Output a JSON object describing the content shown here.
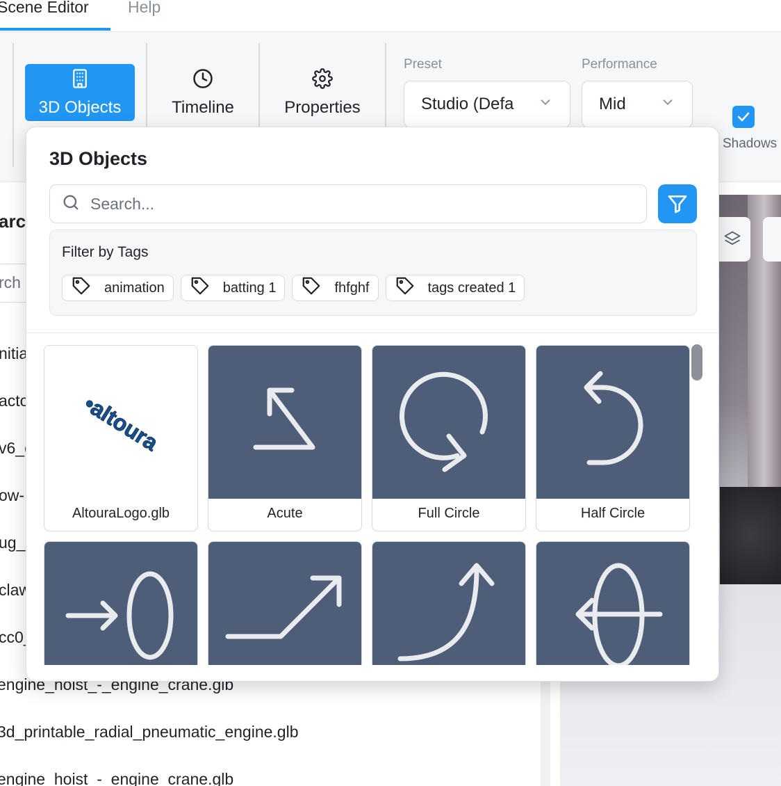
{
  "menu": {
    "tabs": [
      {
        "label": "Scene Editor",
        "active": true
      },
      {
        "label": "Help",
        "active": false
      }
    ]
  },
  "toolbar": {
    "buttons": [
      {
        "label": "3D Objects",
        "icon": "building-icon",
        "active": true
      },
      {
        "label": "Timeline",
        "icon": "clock-icon",
        "active": false
      },
      {
        "label": "Properties",
        "icon": "gear-icon",
        "active": false
      }
    ],
    "preset": {
      "label": "Preset",
      "value": "Studio (Defa"
    },
    "performance": {
      "label": "Performance",
      "value": "Mid"
    },
    "shadows": {
      "label": "Shadows",
      "checked": true
    },
    "accent_color": "#2196f3"
  },
  "left_panel": {
    "heading_fragment": "arcl",
    "search_fragment": "rch",
    "items": [
      "nitia",
      "acto",
      "v6_c",
      "ow-",
      "ug_",
      "claw",
      "cc0_",
      "engine_hoist_-_engine_crane.glb",
      "3d_printable_radial_pneumatic_engine.glb",
      "engine_hoist_-_engine_crane.glb"
    ]
  },
  "popup": {
    "title": "3D Objects",
    "search": {
      "placeholder": "Search...",
      "value": ""
    },
    "tags_panel": {
      "title": "Filter by Tags",
      "tags": [
        "animation",
        "batting 1",
        "fhfghf",
        "tags created 1"
      ]
    },
    "objects": [
      {
        "name": "AltouraLogo.glb",
        "icon": "altoura-logo-icon"
      },
      {
        "name": "Acute",
        "icon": "acute-arrow-icon"
      },
      {
        "name": "Full Circle",
        "icon": "full-circle-arrow-icon"
      },
      {
        "name": "Half Circle",
        "icon": "half-circle-arrow-icon"
      },
      {
        "name": "",
        "icon": "arrow-into-ring-icon"
      },
      {
        "name": "",
        "icon": "step-up-arrow-icon"
      },
      {
        "name": "",
        "icon": "curve-up-arrow-icon"
      },
      {
        "name": "",
        "icon": "arrow-through-ring-icon"
      }
    ]
  }
}
